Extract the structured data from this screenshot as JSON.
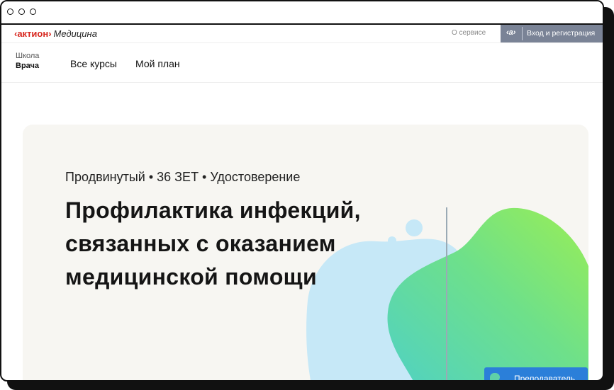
{
  "header": {
    "brand_logo": "‹актион›",
    "brand_sub": "Медицина",
    "about_link": "О сервисе",
    "account_logo": "‹а›",
    "login_label": "Вход и регистрация"
  },
  "nav": {
    "school_line1": "Школа",
    "school_line2": "Врача",
    "links": [
      "Все курсы",
      "Мой план"
    ]
  },
  "hero": {
    "meta": "Продвинутый • 36 ЗЕТ • Удостоверение",
    "title": "Профилактика инфекций, связанных с оказанием медицинской помощи",
    "teacher_button": "Преподаватель"
  },
  "colors": {
    "brand_red": "#d7261e",
    "login_bg": "#7a8396",
    "hero_bg": "#f7f6f2",
    "blob_light_blue": "#c6e8f7",
    "blob_green": "#8be86a",
    "blob_teal": "#4fd1c5",
    "button_blue": "#2b7fd9"
  }
}
